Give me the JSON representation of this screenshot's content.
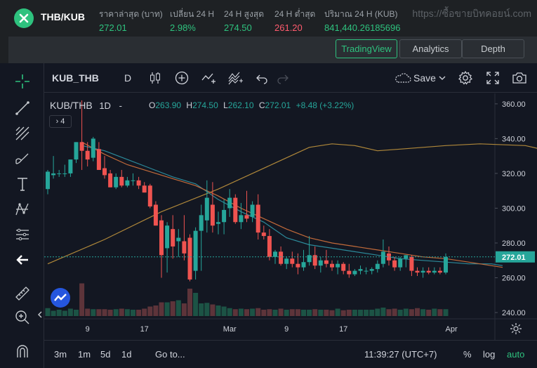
{
  "topbar": {
    "pair": "THB/KUB",
    "stats": [
      {
        "label": "ราคาล่าสุด (บาท)",
        "value": "272.01",
        "color": "green"
      },
      {
        "label": "เปลี่ยน 24 H",
        "value": "2.98%",
        "color": "green"
      },
      {
        "label": "24 H สูงสุด",
        "value": "274.50",
        "color": "green"
      },
      {
        "label": "24 H ต่ำสุด",
        "value": "261.20",
        "color": "red"
      },
      {
        "label": "ปริมาณ 24 H (KUB)",
        "value": "841,440.26185696",
        "color": "green"
      }
    ],
    "watermark": "https://ซื้อขายบิทคอยน์.com"
  },
  "views": {
    "tradingview": "TradingView",
    "analytics": "Analytics",
    "depth": "Depth",
    "active": "tradingview"
  },
  "toolbar": {
    "symbol": "KUB_THB",
    "interval": "D",
    "save_label": "Save"
  },
  "legend": {
    "symbol": "KUB/THB",
    "interval": "1D",
    "dash": "-",
    "open_key": "O",
    "open": "263.90",
    "high_key": "H",
    "high": "274.50",
    "low_key": "L",
    "low": "262.10",
    "close_key": "C",
    "close": "272.01",
    "change": "+8.48 (+3.22%)",
    "indicators_count": "4"
  },
  "bottombar": {
    "ranges": [
      "3m",
      "1m",
      "5d",
      "1d"
    ],
    "goto": "Go to...",
    "time": "11:39:27 (UTC+7)",
    "percent": "%",
    "log": "log",
    "auto": "auto"
  },
  "colors": {
    "accent": "#2ec27e",
    "up": "#26a69a",
    "down": "#ef5350",
    "chart_bg": "#131722"
  },
  "icons": [
    "crosshair-icon",
    "trend-line-icon",
    "fib-icon",
    "brush-icon",
    "text-icon",
    "pattern-icon",
    "measure-icon",
    "back-arrow-icon",
    "ruler-icon",
    "zoom-in-icon",
    "magnet-icon",
    "candles-icon",
    "add-indicator-icon",
    "compare-icon",
    "indicators-icon",
    "undo-icon",
    "redo-icon",
    "cloud-icon",
    "settings-icon",
    "fullscreen-icon",
    "camera-icon"
  ],
  "chart_data": {
    "type": "candlestick",
    "title": "KUB/THB 1D",
    "ylim": [
      238,
      366
    ],
    "y_ticks": [
      "240.00",
      "260.00",
      "280.00",
      "300.00",
      "320.00",
      "340.00",
      "360.00"
    ],
    "x_ticks": [
      "9",
      "17",
      "Mar",
      "9",
      "17",
      "Apr"
    ],
    "last_price": "272.01",
    "candles": [
      {
        "o": 311,
        "h": 322,
        "l": 308,
        "c": 321
      },
      {
        "o": 319,
        "h": 330,
        "l": 317,
        "c": 320
      },
      {
        "o": 320,
        "h": 322,
        "l": 318,
        "c": 320
      },
      {
        "o": 320,
        "h": 325,
        "l": 318,
        "c": 320
      },
      {
        "o": 320,
        "h": 328,
        "l": 318,
        "c": 328
      },
      {
        "o": 328,
        "h": 338,
        "l": 326,
        "c": 338
      },
      {
        "o": 338,
        "h": 362,
        "l": 322,
        "c": 333
      },
      {
        "o": 333,
        "h": 338,
        "l": 324,
        "c": 328
      },
      {
        "o": 329,
        "h": 341,
        "l": 327,
        "c": 340
      },
      {
        "o": 334,
        "h": 338,
        "l": 322,
        "c": 322
      },
      {
        "o": 323,
        "h": 330,
        "l": 317,
        "c": 319
      },
      {
        "o": 320,
        "h": 322,
        "l": 312,
        "c": 312
      },
      {
        "o": 312,
        "h": 320,
        "l": 311,
        "c": 318
      },
      {
        "o": 318,
        "h": 322,
        "l": 312,
        "c": 313
      },
      {
        "o": 313,
        "h": 318,
        "l": 312,
        "c": 316
      },
      {
        "o": 316,
        "h": 320,
        "l": 313,
        "c": 316
      },
      {
        "o": 316,
        "h": 318,
        "l": 311,
        "c": 313
      },
      {
        "o": 313,
        "h": 315,
        "l": 309,
        "c": 309
      },
      {
        "o": 313,
        "h": 314,
        "l": 300,
        "c": 301
      },
      {
        "o": 302,
        "h": 304,
        "l": 290,
        "c": 290
      },
      {
        "o": 293,
        "h": 296,
        "l": 260,
        "c": 273
      },
      {
        "o": 277,
        "h": 292,
        "l": 263,
        "c": 290
      },
      {
        "o": 288,
        "h": 296,
        "l": 271,
        "c": 278
      },
      {
        "o": 281,
        "h": 288,
        "l": 272,
        "c": 283
      },
      {
        "o": 281,
        "h": 296,
        "l": 270,
        "c": 274
      },
      {
        "o": 283,
        "h": 285,
        "l": 258,
        "c": 259
      },
      {
        "o": 264,
        "h": 289,
        "l": 259,
        "c": 287
      },
      {
        "o": 287,
        "h": 302,
        "l": 264,
        "c": 296
      },
      {
        "o": 293,
        "h": 316,
        "l": 286,
        "c": 306
      },
      {
        "o": 302,
        "h": 315,
        "l": 286,
        "c": 290
      },
      {
        "o": 291,
        "h": 298,
        "l": 285,
        "c": 292
      },
      {
        "o": 292,
        "h": 305,
        "l": 285,
        "c": 299
      },
      {
        "o": 300,
        "h": 311,
        "l": 295,
        "c": 306
      },
      {
        "o": 306,
        "h": 308,
        "l": 291,
        "c": 292
      },
      {
        "o": 292,
        "h": 303,
        "l": 288,
        "c": 296
      },
      {
        "o": 296,
        "h": 310,
        "l": 292,
        "c": 294
      },
      {
        "o": 295,
        "h": 304,
        "l": 292,
        "c": 302
      },
      {
        "o": 302,
        "h": 308,
        "l": 282,
        "c": 286
      },
      {
        "o": 286,
        "h": 290,
        "l": 282,
        "c": 284
      },
      {
        "o": 284,
        "h": 288,
        "l": 270,
        "c": 272
      },
      {
        "o": 272,
        "h": 276,
        "l": 268,
        "c": 275
      },
      {
        "o": 275,
        "h": 278,
        "l": 267,
        "c": 268
      },
      {
        "o": 268,
        "h": 272,
        "l": 265,
        "c": 271
      },
      {
        "o": 271,
        "h": 275,
        "l": 266,
        "c": 268
      },
      {
        "o": 268,
        "h": 274,
        "l": 262,
        "c": 266
      },
      {
        "o": 266,
        "h": 276,
        "l": 264,
        "c": 269
      },
      {
        "o": 269,
        "h": 284,
        "l": 267,
        "c": 273
      },
      {
        "o": 273,
        "h": 278,
        "l": 265,
        "c": 267
      },
      {
        "o": 267,
        "h": 272,
        "l": 263,
        "c": 270
      },
      {
        "o": 270,
        "h": 276,
        "l": 266,
        "c": 268
      },
      {
        "o": 268,
        "h": 270,
        "l": 264,
        "c": 266
      },
      {
        "o": 266,
        "h": 270,
        "l": 262,
        "c": 268
      },
      {
        "o": 268,
        "h": 269,
        "l": 262,
        "c": 264
      },
      {
        "o": 264,
        "h": 268,
        "l": 260,
        "c": 262
      },
      {
        "o": 262,
        "h": 265,
        "l": 261,
        "c": 264
      },
      {
        "o": 264,
        "h": 267,
        "l": 262,
        "c": 265
      },
      {
        "o": 264,
        "h": 266,
        "l": 262,
        "c": 264
      },
      {
        "o": 264,
        "h": 266,
        "l": 262,
        "c": 265
      },
      {
        "o": 265,
        "h": 270,
        "l": 263,
        "c": 268
      },
      {
        "o": 268,
        "h": 282,
        "l": 266,
        "c": 275
      },
      {
        "o": 274,
        "h": 278,
        "l": 267,
        "c": 270
      },
      {
        "o": 270,
        "h": 272,
        "l": 264,
        "c": 266
      },
      {
        "o": 266,
        "h": 272,
        "l": 264,
        "c": 271
      },
      {
        "o": 271,
        "h": 273,
        "l": 266,
        "c": 273
      },
      {
        "o": 272,
        "h": 273,
        "l": 261,
        "c": 264
      },
      {
        "o": 264,
        "h": 266,
        "l": 261,
        "c": 263
      },
      {
        "o": 263,
        "h": 266,
        "l": 260,
        "c": 264
      },
      {
        "o": 264,
        "h": 266,
        "l": 262,
        "c": 263
      },
      {
        "o": 263,
        "h": 266,
        "l": 262,
        "c": 264
      },
      {
        "o": 264,
        "h": 266,
        "l": 262,
        "c": 263
      },
      {
        "o": 263,
        "h": 274,
        "l": 262,
        "c": 272
      }
    ],
    "volumes": [
      0.15,
      0.1,
      0.12,
      0.1,
      0.14,
      0.12,
      0.62,
      0.14,
      0.13,
      0.13,
      0.13,
      0.12,
      0.13,
      0.14,
      0.13,
      0.12,
      0.12,
      0.14,
      0.18,
      0.2,
      0.26,
      0.26,
      0.28,
      0.3,
      0.24,
      0.52,
      0.44,
      0.24,
      0.25,
      0.22,
      0.2,
      0.18,
      0.15,
      0.13,
      0.14,
      0.13,
      0.14,
      0.15,
      0.12,
      0.13,
      0.12,
      0.14,
      0.12,
      0.13,
      0.13,
      0.12,
      0.12,
      0.13,
      0.12,
      0.12,
      0.11,
      0.14,
      0.11,
      0.12,
      0.12,
      0.12,
      0.12,
      0.12,
      0.14,
      0.16,
      0.13,
      0.14,
      0.12,
      0.14,
      0.13,
      0.15,
      0.13,
      0.12,
      0.14,
      0.13,
      0.13
    ],
    "ma_long": [
      [
        0,
        268
      ],
      [
        10,
        282
      ],
      [
        20,
        298
      ],
      [
        30,
        311
      ],
      [
        40,
        326
      ],
      [
        46,
        335
      ],
      [
        50,
        337
      ],
      [
        54,
        336
      ],
      [
        58,
        333
      ],
      [
        62,
        334
      ],
      [
        66,
        335
      ],
      [
        70,
        336
      ],
      [
        76,
        337
      ],
      [
        84,
        336
      ],
      [
        88,
        333
      ]
    ],
    "ma_mid": [
      [
        6,
        336
      ],
      [
        10,
        333
      ],
      [
        14,
        328
      ],
      [
        18,
        323
      ],
      [
        22,
        318
      ],
      [
        26,
        314
      ],
      [
        30,
        305
      ],
      [
        34,
        298
      ],
      [
        38,
        292
      ],
      [
        42,
        283
      ],
      [
        46,
        279
      ],
      [
        50,
        277
      ],
      [
        54,
        275
      ],
      [
        58,
        273
      ],
      [
        62,
        271
      ],
      [
        66,
        270
      ],
      [
        70,
        269
      ],
      [
        74,
        268
      ],
      [
        78,
        268
      ],
      [
        80,
        267
      ]
    ],
    "ma_short": [
      [
        6,
        338
      ],
      [
        10,
        331
      ],
      [
        14,
        325
      ],
      [
        18,
        321
      ],
      [
        22,
        317
      ],
      [
        26,
        313
      ],
      [
        30,
        307
      ],
      [
        34,
        300
      ],
      [
        38,
        294
      ],
      [
        42,
        288
      ],
      [
        46,
        283
      ],
      [
        50,
        280
      ],
      [
        54,
        278
      ],
      [
        58,
        276
      ],
      [
        62,
        274
      ],
      [
        66,
        272
      ],
      [
        70,
        271
      ],
      [
        74,
        269
      ],
      [
        78,
        267
      ],
      [
        80,
        266
      ]
    ]
  }
}
